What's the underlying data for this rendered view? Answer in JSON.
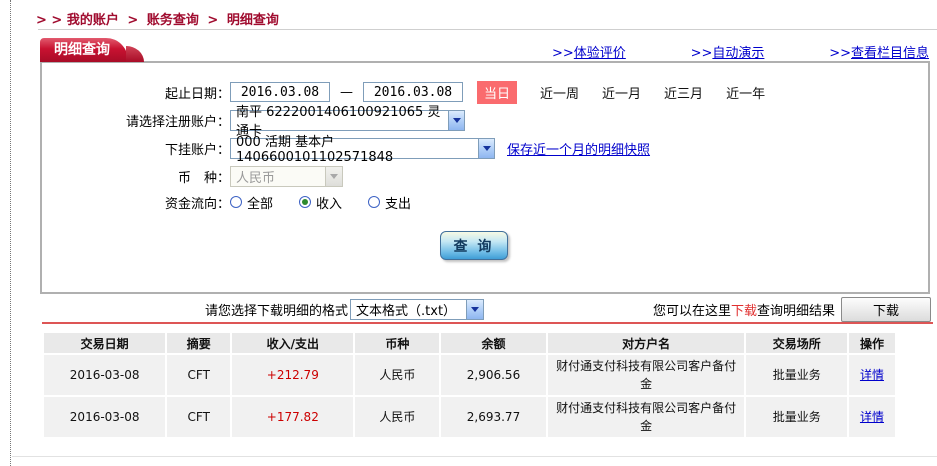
{
  "colors": {
    "brand_red": "#a00c2f",
    "tab_red": "#c8122f",
    "badge_red": "#fa6b6e",
    "link_blue": "#0000cc",
    "amount_red": "#cc0000",
    "divider_red": "#dd5555"
  },
  "page": {
    "breadcrumb_prefix": "> >",
    "breadcrumb_separator": ">",
    "breadcrumb_items": [
      "我的账户",
      "账务查询",
      "明细查询"
    ],
    "tab_title": "明细查询",
    "top_links": [
      {
        "prefix": ">>",
        "label": "体验评价"
      },
      {
        "prefix": ">>",
        "label": "自动演示"
      },
      {
        "prefix": ">>",
        "label": "查看栏目信息"
      }
    ]
  },
  "form": {
    "date_label": "起止日期：",
    "date_from": "2016.03.08",
    "date_dash": "—",
    "date_to": "2016.03.08",
    "quick_today": "当日",
    "quick_ranges": [
      "近一周",
      "近一月",
      "近三月",
      "近一年"
    ],
    "register_account_label": "请选择注册账户：",
    "register_account_value": "南平 6222001406100921065 灵通卡",
    "sub_account_label": "下挂账户：",
    "sub_account_value": "000 活期 基本户 1406600101102571848",
    "snapshot_link": "保存近一个月的明细快照",
    "currency_label": "币　种：",
    "currency_value": "人民币",
    "flow_label": "资金流向：",
    "flow_options": [
      {
        "label": "全部",
        "checked": false
      },
      {
        "label": "收入",
        "checked": true
      },
      {
        "label": "支出",
        "checked": false
      }
    ],
    "query_button": "查 询"
  },
  "download": {
    "format_label": "请您选择下载明细的格式",
    "format_value": "文本格式（.txt）",
    "hint_prefix": "您可以在这里",
    "hint_link": "下载",
    "hint_suffix": "查询明细结果",
    "button_label": "下载"
  },
  "table": {
    "headers": [
      "交易日期",
      "摘要",
      "收入/支出",
      "币种",
      "余额",
      "对方户名",
      "交易场所",
      "操作"
    ],
    "rows": [
      {
        "date": "2016-03-08",
        "summary": "CFT",
        "amount": "+212.79",
        "currency": "人民币",
        "balance": "2,906.56",
        "counterparty": "财付通支付科技有限公司客户备付金",
        "venue": "批量业务",
        "action": "详情"
      },
      {
        "date": "2016-03-08",
        "summary": "CFT",
        "amount": "+177.82",
        "currency": "人民币",
        "balance": "2,693.77",
        "counterparty": "财付通支付科技有限公司客户备付金",
        "venue": "批量业务",
        "action": "详情"
      }
    ]
  }
}
